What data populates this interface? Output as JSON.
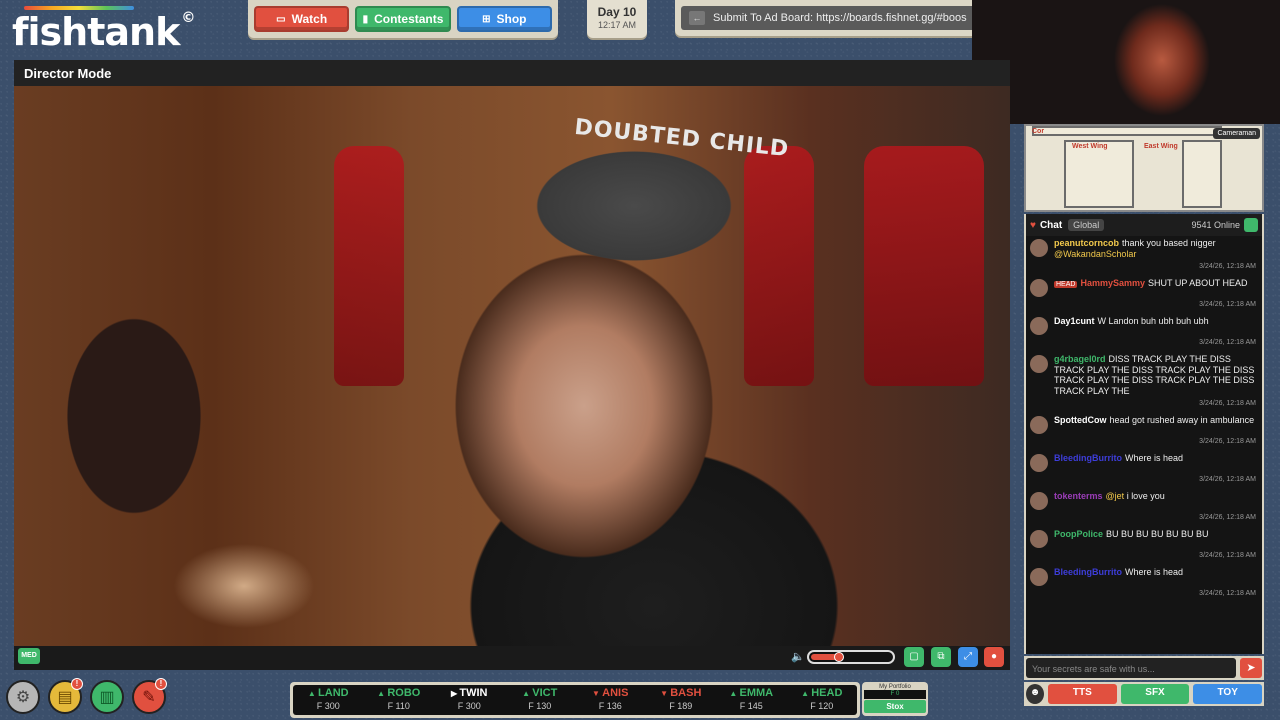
{
  "app": {
    "logo": "fishtank",
    "logo_mark": "©"
  },
  "nav": {
    "watch": "Watch",
    "contestants": "Contestants",
    "shop": "Shop"
  },
  "day": {
    "label": "Day 10",
    "time": "12:17 AM"
  },
  "ad_board": {
    "text": "Submit To Ad Board: https://boards.fishnet.gg/#boos"
  },
  "player": {
    "title": "Director Mode",
    "quality": "MED",
    "volume": 0.35,
    "overlay_text": "DOUBTED CHILD"
  },
  "map": {
    "west_wing": "West Wing",
    "east_wing": "East Wing",
    "corridor": "Cor",
    "camera_tag": "Cameraman"
  },
  "chat": {
    "title": "Chat",
    "scope": "Global",
    "online": "9541 Online",
    "placeholder": "Your secrets are safe with us...",
    "messages": [
      {
        "user": "peanutcorncob",
        "color": "#f2c94c",
        "badge": "",
        "text": "thank you based nigger",
        "mention": "@WakandanScholar",
        "time": "3/24/26, 12:18 AM"
      },
      {
        "user": "HammySammy",
        "color": "#e1503f",
        "badge": "HEAD",
        "text": "SHUT UP ABOUT HEAD",
        "mention": "",
        "time": "3/24/26, 12:18 AM"
      },
      {
        "user": "Day1cunt",
        "color": "#ffffff",
        "badge": "",
        "text": "W Landon buh ubh buh ubh",
        "mention": "",
        "time": "3/24/26, 12:18 AM"
      },
      {
        "user": "g4rbagel0rd",
        "color": "#3fb86b",
        "badge": "",
        "text": "DISS TRACK PLAY THE DISS TRACK PLAY THE DISS TRACK PLAY THE DISS TRACK PLAY THE DISS TRACK PLAY THE DISS TRACK PLAY THE",
        "mention": "",
        "time": "3/24/26, 12:18 AM"
      },
      {
        "user": "SpottedCow",
        "color": "#ffffff",
        "badge": "",
        "text": "head got rushed away in ambulance",
        "mention": "",
        "time": "3/24/26, 12:18 AM"
      },
      {
        "user": "BleedingBurrito",
        "color": "#3d3dd9",
        "badge": "",
        "text": "Where is head",
        "mention": "",
        "time": "3/24/26, 12:18 AM"
      },
      {
        "user": "tokenterms",
        "color": "#9b3db8",
        "badge": "",
        "text": "i love you",
        "mention": "@jet",
        "time": "3/24/26, 12:18 AM"
      },
      {
        "user": "PoopPolice",
        "color": "#3fb86b",
        "badge": "",
        "text": "BU BU BU BU BU BU BU",
        "mention": "",
        "time": "3/24/26, 12:18 AM"
      },
      {
        "user": "BleedingBurrito",
        "color": "#3d3dd9",
        "badge": "",
        "text": "Where is head",
        "mention": "",
        "time": "3/24/26, 12:18 AM"
      }
    ],
    "actions": {
      "tts": "TTS",
      "sfx": "SFX",
      "toy": "TOY"
    }
  },
  "bottom_icons": {
    "gold_notif": "!",
    "red_notif": "!"
  },
  "ticker": [
    {
      "name": "LAND",
      "price": "F 300",
      "dir": "up"
    },
    {
      "name": "ROBO",
      "price": "F 110",
      "dir": "up"
    },
    {
      "name": "TWIN",
      "price": "F 300",
      "dir": "flat"
    },
    {
      "name": "VICT",
      "price": "F 130",
      "dir": "up"
    },
    {
      "name": "ANIS",
      "price": "F 136",
      "dir": "down"
    },
    {
      "name": "BASH",
      "price": "F 189",
      "dir": "down"
    },
    {
      "name": "EMMA",
      "price": "F 145",
      "dir": "up"
    },
    {
      "name": "HEAD",
      "price": "F 120",
      "dir": "up"
    }
  ],
  "portfolio": {
    "label": "My Portfolio",
    "value": "F 0",
    "stox": "Stox"
  },
  "colors": {
    "red": "#e1503f",
    "green": "#3fb86b",
    "blue": "#3d8ee6",
    "panel": "#d9d4c3"
  }
}
